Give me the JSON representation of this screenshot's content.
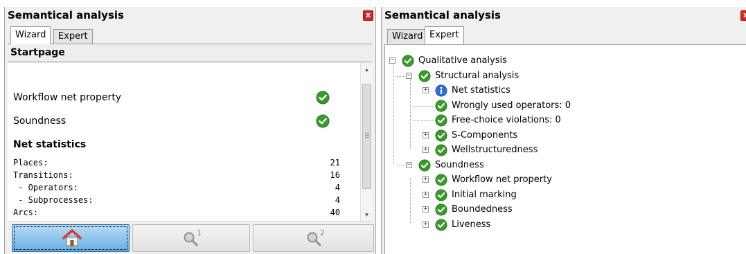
{
  "left_panel": {
    "title": "Semantical analysis",
    "close_symbol": "x",
    "tabs": [
      {
        "label": "Wizard",
        "active": true
      },
      {
        "label": "Expert",
        "active": false
      }
    ],
    "page_title": "Startpage",
    "properties": [
      {
        "label": "Workflow net property",
        "status_icon": "check-icon"
      },
      {
        "label": "Soundness",
        "status_icon": "check-icon"
      }
    ],
    "net_statistics_title": "Net statistics",
    "stats": [
      {
        "label": "Places:",
        "value": "21"
      },
      {
        "label": "Transitions:",
        "value": "16"
      },
      {
        "label": " - Operators:",
        "value": "4"
      },
      {
        "label": " - Subprocesses:",
        "value": "4"
      },
      {
        "label": "Arcs:",
        "value": "40"
      }
    ],
    "buttons": [
      {
        "name": "home",
        "icon": "home-icon",
        "badge": ""
      },
      {
        "name": "search-1",
        "icon": "magnifier-icon",
        "badge": "1"
      },
      {
        "name": "search-2",
        "icon": "magnifier-icon",
        "badge": "2"
      }
    ]
  },
  "right_panel": {
    "title": "Semantical analysis",
    "close_symbol": "x",
    "tabs": [
      {
        "label": "Wizard",
        "active": false
      },
      {
        "label": "Expert",
        "active": true
      }
    ],
    "tree": [
      {
        "label": "Qualitative analysis",
        "level": 0,
        "expander": "−",
        "icon": "check-icon"
      },
      {
        "label": "Structural analysis",
        "level": 1,
        "expander": "−",
        "icon": "check-icon"
      },
      {
        "label": "Net statistics",
        "level": 2,
        "expander": "+",
        "icon": "info-icon"
      },
      {
        "label": "Wrongly used operators: 0",
        "level": 2,
        "expander": "",
        "icon": "check-icon"
      },
      {
        "label": "Free-choice violations: 0",
        "level": 2,
        "expander": "",
        "icon": "check-icon"
      },
      {
        "label": "S-Components",
        "level": 2,
        "expander": "+",
        "icon": "check-icon"
      },
      {
        "label": "Wellstructuredness",
        "level": 2,
        "expander": "+",
        "icon": "check-icon"
      },
      {
        "label": "Soundness",
        "level": 1,
        "expander": "−",
        "icon": "check-icon"
      },
      {
        "label": "Workflow net property",
        "level": 2,
        "expander": "+",
        "icon": "check-icon"
      },
      {
        "label": "Initial marking",
        "level": 2,
        "expander": "+",
        "icon": "check-icon"
      },
      {
        "label": "Boundedness",
        "level": 2,
        "expander": "+",
        "icon": "check-icon"
      },
      {
        "label": "Liveness",
        "level": 2,
        "expander": "+",
        "icon": "check-icon"
      }
    ]
  },
  "colors": {
    "check_green": "#3a9a2c",
    "info_blue": "#2d6fd1",
    "close_red": "#d42a1c",
    "home_roof": "#d23a2a"
  }
}
